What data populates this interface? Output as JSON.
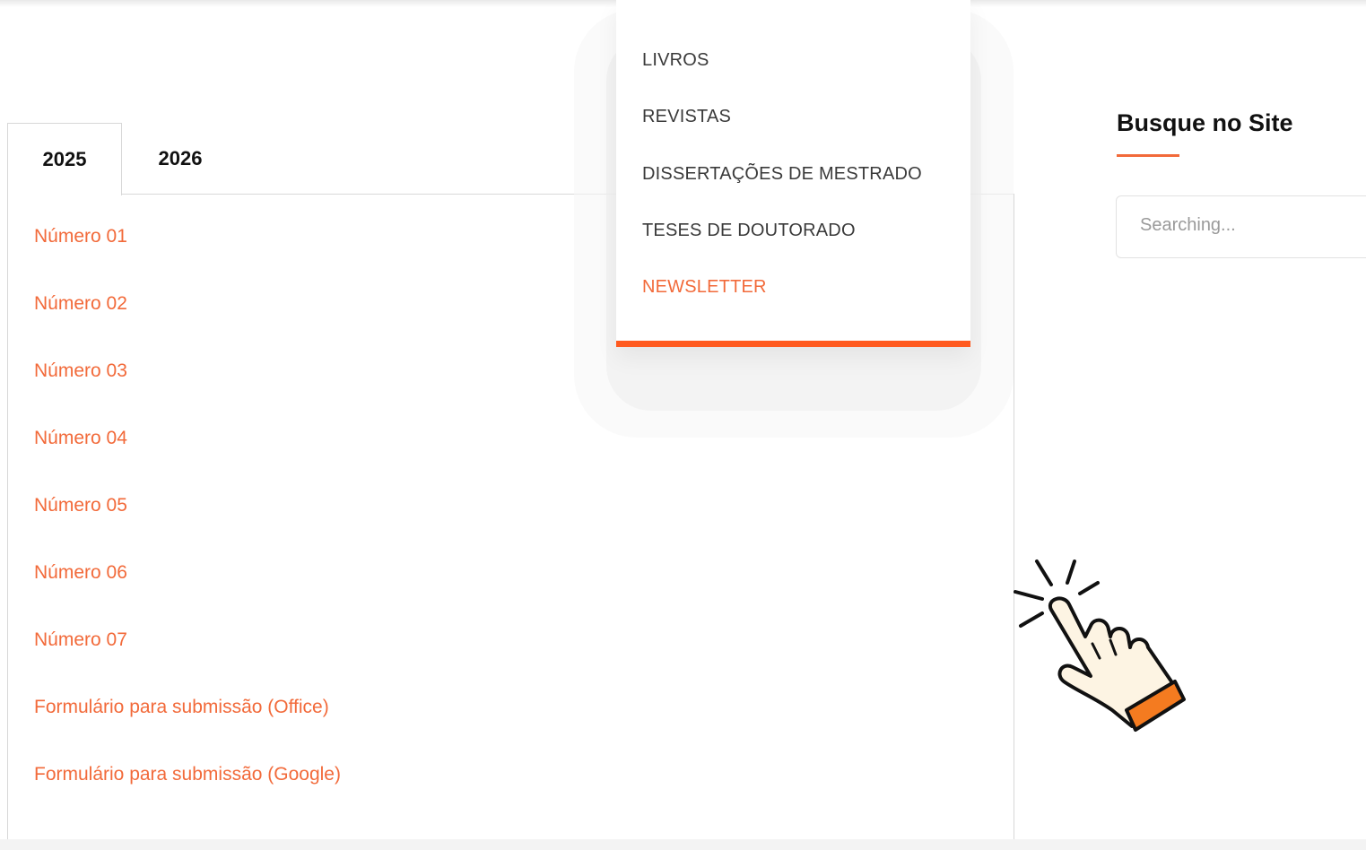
{
  "tabs": [
    {
      "label": "2025",
      "active": true
    },
    {
      "label": "2026",
      "active": false
    }
  ],
  "links": [
    "Número 01",
    "Número 02",
    "Número 03",
    "Número 04",
    "Número 05",
    "Número 06",
    "Número 07",
    "Formulário para submissão (Office)",
    "Formulário para submissão (Google)"
  ],
  "dropdown": {
    "items": [
      "LIVROS",
      "REVISTAS",
      "DISSERTAÇÕES DE MESTRADO",
      "TESES DE DOUTORADO",
      "NEWSLETTER"
    ],
    "active_item": "NEWSLETTER"
  },
  "sidebar": {
    "title": "Busque no Site",
    "search_placeholder": "Searching..."
  },
  "colors": {
    "accent": "#f26a3a",
    "dropdown_border": "#ff5a1f",
    "hand_cuff": "#f47b20",
    "hand_fill": "#fdf4e3"
  },
  "icons": {
    "pointer": "hand-pointer-icon"
  }
}
